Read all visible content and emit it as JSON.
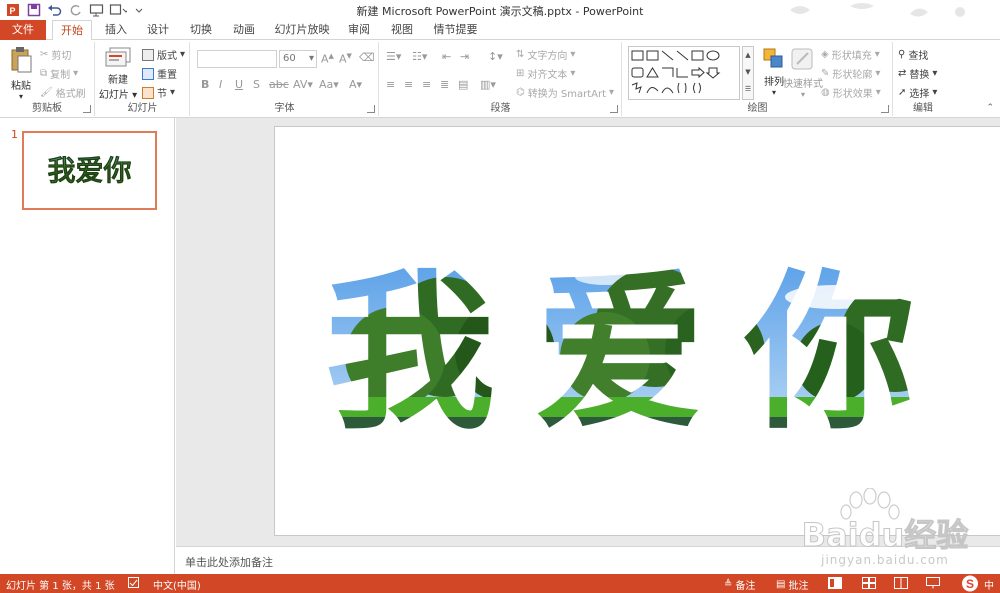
{
  "window": {
    "title": "新建 Microsoft PowerPoint 演示文稿.pptx - PowerPoint"
  },
  "tabs": [
    {
      "label": "文件"
    },
    {
      "label": "开始"
    },
    {
      "label": "插入"
    },
    {
      "label": "设计"
    },
    {
      "label": "切换"
    },
    {
      "label": "动画"
    },
    {
      "label": "幻灯片放映"
    },
    {
      "label": "审阅"
    },
    {
      "label": "视图"
    },
    {
      "label": "情节提要"
    }
  ],
  "ribbon": {
    "clipboard": {
      "label": "剪贴板",
      "paste": "粘贴",
      "cut": "剪切",
      "copy": "复制",
      "format_painter": "格式刷"
    },
    "slides": {
      "label": "幻灯片",
      "new_slide_line1": "新建",
      "new_slide_line2": "幻灯片",
      "layout": "版式",
      "reset": "重置",
      "section": "节"
    },
    "font": {
      "label": "字体",
      "size": "60"
    },
    "paragraph": {
      "label": "段落",
      "text_direction": "文字方向",
      "align_text": "对齐文本",
      "smartart": "转换为 SmartArt"
    },
    "drawing": {
      "label": "绘图",
      "arrange": "排列",
      "quick_styles": "快速样式",
      "shape_fill": "形状填充",
      "shape_outline": "形状轮廓",
      "shape_effects": "形状效果"
    },
    "editing": {
      "label": "编辑",
      "find": "查找",
      "replace": "替换",
      "select": "选择"
    }
  },
  "slides_panel": {
    "slide_number": "1",
    "thumb_text": "我爱你"
  },
  "slide": {
    "text": "我爱你"
  },
  "notes": {
    "placeholder": "单击此处添加备注"
  },
  "statusbar": {
    "slide_info": "幻灯片 第 1 张，共 1 张",
    "language": "中文(中国)",
    "notes": "备注",
    "comments": "批注",
    "ime": "中"
  },
  "watermark": {
    "brand": "Baidu经验",
    "url": "jingyan.baidu.com"
  },
  "colors": {
    "accent": "#d24726",
    "active_tab_text": "#c5441f",
    "sky": "#5aa0e8",
    "foliage": "#2f6b22",
    "grass": "#4caf2c"
  }
}
